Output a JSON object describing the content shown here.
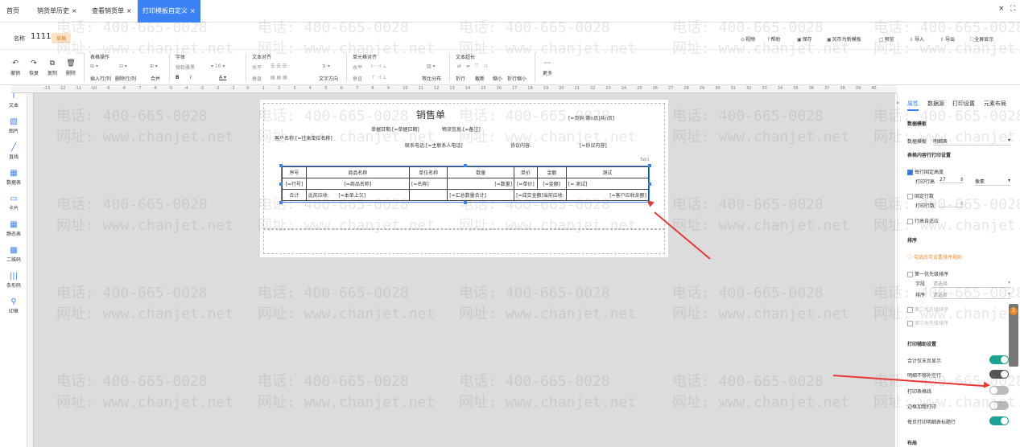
{
  "tabs": [
    {
      "label": "首页",
      "closable": false
    },
    {
      "label": "销货单历史",
      "closable": true
    },
    {
      "label": "查看销货单",
      "closable": true
    },
    {
      "label": "打印模板自定义",
      "closable": true,
      "active": true
    }
  ],
  "window": {
    "close": "×",
    "fullscreen": "⛶"
  },
  "namebar": {
    "label": "名称",
    "value": "1111",
    "tag": "草稿"
  },
  "top_actions": [
    {
      "icon": "video-icon",
      "label": "视频"
    },
    {
      "icon": "help-icon",
      "label": "帮助"
    },
    {
      "icon": "save-icon",
      "label": "保存"
    },
    {
      "icon": "save-as-icon",
      "label": "另存为新模板"
    },
    {
      "icon": "preview-icon",
      "label": "预览"
    },
    {
      "icon": "import-icon",
      "label": "导入"
    },
    {
      "icon": "export-icon",
      "label": "导出"
    },
    {
      "icon": "fullscreen-icon",
      "label": "全屏显示"
    }
  ],
  "toolbar": {
    "undo": "撤销",
    "redo": "恢复",
    "copy": "复制",
    "delete": "删除",
    "table_ops": "表格操作",
    "insert_row": "插入行/列",
    "delete_row": "删除行/列",
    "merge": "合并",
    "font": "字体",
    "font_name": "微软雅黑",
    "font_size": "10",
    "text_align": "文本对齐",
    "horizontal": "水平",
    "vertical": "垂直",
    "text_dir": "文字方向",
    "cell_align": "单元格对齐",
    "cell_h": "水平",
    "cell_v": "垂直",
    "equal_split": "等比分布",
    "text_overflow": "文本超长",
    "wrap": "折行",
    "truncate": "截断",
    "shrink": "缩小",
    "wrap_shrink": "折行缩小",
    "more": "更多"
  },
  "left_panel": [
    {
      "icon": "text-icon",
      "label": "文本"
    },
    {
      "icon": "image-icon",
      "label": "图片"
    },
    {
      "icon": "line-icon",
      "label": "直线"
    },
    {
      "icon": "data-table-icon",
      "label": "数据表"
    },
    {
      "icon": "card-icon",
      "label": "卡片"
    },
    {
      "icon": "static-table-icon",
      "label": "静态表"
    },
    {
      "icon": "qrcode-icon",
      "label": "二维码"
    },
    {
      "icon": "barcode-icon",
      "label": "条形码"
    },
    {
      "icon": "stamp-icon",
      "label": "印章"
    }
  ],
  "ruler_ticks": [
    "-13",
    "-12",
    "-11",
    "-10",
    "-9",
    "-8",
    "-7",
    "-6",
    "-5",
    "-4",
    "-3",
    "-2",
    "-1",
    "0",
    "1",
    "2",
    "3",
    "4",
    "5",
    "6",
    "7",
    "8",
    "9",
    "10",
    "11",
    "12",
    "13",
    "14",
    "15",
    "16",
    "17",
    "18",
    "19",
    "20",
    "21",
    "22",
    "23",
    "24",
    "25",
    "26",
    "27",
    "28",
    "29",
    "30",
    "31",
    "32",
    "33",
    "34",
    "35",
    "36",
    "37",
    "38",
    "39",
    "40"
  ],
  "paper": {
    "title": "销售单",
    "page_info": "[=页码:第n页|共n页]",
    "date": "单据日期:[=单据日期]",
    "logistics": "物流信息:[=备注]",
    "customer": "客户名称:[=往来单位名称]",
    "contact": "联系电话:[=主联系人电话]",
    "agreement": "协议内容:",
    "agreement_val": "[=协议内容]",
    "table_label": "Tab1"
  },
  "table": {
    "headers": [
      "序号",
      "商品名称",
      "单位名称",
      "数量",
      "单价",
      "金额",
      "测试"
    ],
    "row": [
      "[=行号]",
      "[=商品名称]",
      "[=名称]",
      "[=数量]",
      "[=单价]",
      "[=金额]",
      "[= 测试]"
    ],
    "total": [
      "合计",
      "此前应收:",
      "[=本单上欠]",
      "[=汇总数量合计]",
      "[=成交金额]",
      "当前应收:",
      "[=客户应收余额]"
    ]
  },
  "right_panel": {
    "tabs": [
      "属性",
      "数据源",
      "打印设置",
      "元素布局"
    ],
    "data_template": "数据模板",
    "data_template_label": "数据模板",
    "data_template_value": "明细表",
    "table_print": "表格内容行打印设置",
    "fixed_height": "每行固定高度",
    "print_rows": "打印行高",
    "row_height": "27",
    "unit": "像素",
    "fixed_rows": "固定行数",
    "print_row_count": "打印行数",
    "auto_fill": "行高自适应",
    "sort": "排序",
    "sort_warn": "勾选后可设置排序规则",
    "first_sort": "第一优先级排序",
    "field": "字段",
    "order": "排序",
    "placeholder": "请选择",
    "second_sort": "第二优先级排序",
    "third_sort": "第三优先级排序",
    "print_assist": "打印辅助设置",
    "total_last_only": "合计仅末页显示",
    "no_print_empty": "明细不够补空行",
    "print_grid": "打印表格线",
    "border_bold": "边框加粗打印",
    "repeat_header": "每页打印明细表标题行",
    "layout": "布局"
  },
  "watermark": {
    "phone": "电话: 400-665-0028",
    "site": "网址: www.chanjet.net"
  },
  "badge": {
    "count": "2"
  }
}
